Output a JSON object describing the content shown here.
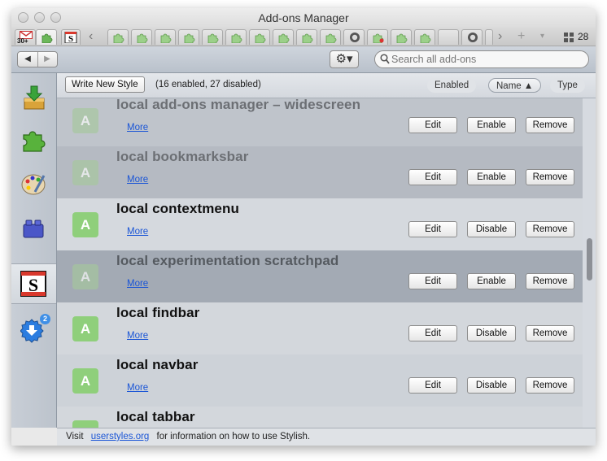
{
  "window": {
    "title": "Add-ons Manager"
  },
  "tabs": {
    "gmail_badge": "30+",
    "tab_count": "28",
    "plus_label": "+",
    "dropdown_label": "▾",
    "colors": {
      "puzzle": "#7cc06a"
    }
  },
  "toolbar": {
    "back_label": "◀",
    "forward_label": "▶",
    "gear_label": "⚙▾",
    "search_placeholder": "Search all add-ons"
  },
  "sidebar": {
    "items": [
      {
        "name": "get-addons",
        "icon": "download-box-icon"
      },
      {
        "name": "extensions",
        "icon": "puzzle-icon"
      },
      {
        "name": "appearance",
        "icon": "palette-icon"
      },
      {
        "name": "plugins",
        "icon": "lego-brick-icon"
      },
      {
        "name": "user-styles",
        "icon": "stylish-icon",
        "selected": true
      },
      {
        "name": "updates",
        "icon": "update-icon",
        "badge": "2"
      }
    ]
  },
  "header": {
    "write_new_style": "Write New Style",
    "count_text": "(16 enabled, 27 disabled)",
    "sort": {
      "enabled": "Enabled",
      "name": "Name ▲",
      "type": "Type"
    }
  },
  "buttons": {
    "edit": "Edit",
    "enable": "Enable",
    "disable": "Disable",
    "remove": "Remove",
    "more": "More"
  },
  "styles": [
    {
      "name": "local add-ons manager – widescreen",
      "enabled": false,
      "toggle": "Enable"
    },
    {
      "name": "local bookmarksbar",
      "enabled": false,
      "toggle": "Enable"
    },
    {
      "name": "local contextmenu",
      "enabled": true,
      "toggle": "Disable"
    },
    {
      "name": "local experimentation scratchpad",
      "enabled": false,
      "toggle": "Enable"
    },
    {
      "name": "local findbar",
      "enabled": true,
      "toggle": "Disable"
    },
    {
      "name": "local navbar",
      "enabled": true,
      "toggle": "Disable"
    },
    {
      "name": "local tabbar",
      "enabled": true,
      "toggle": "Disable"
    }
  ],
  "style_icon_letter": "A",
  "footer": {
    "visit": "Visit",
    "link": "userstyles.org",
    "rest": "for information on how to use Stylish."
  }
}
